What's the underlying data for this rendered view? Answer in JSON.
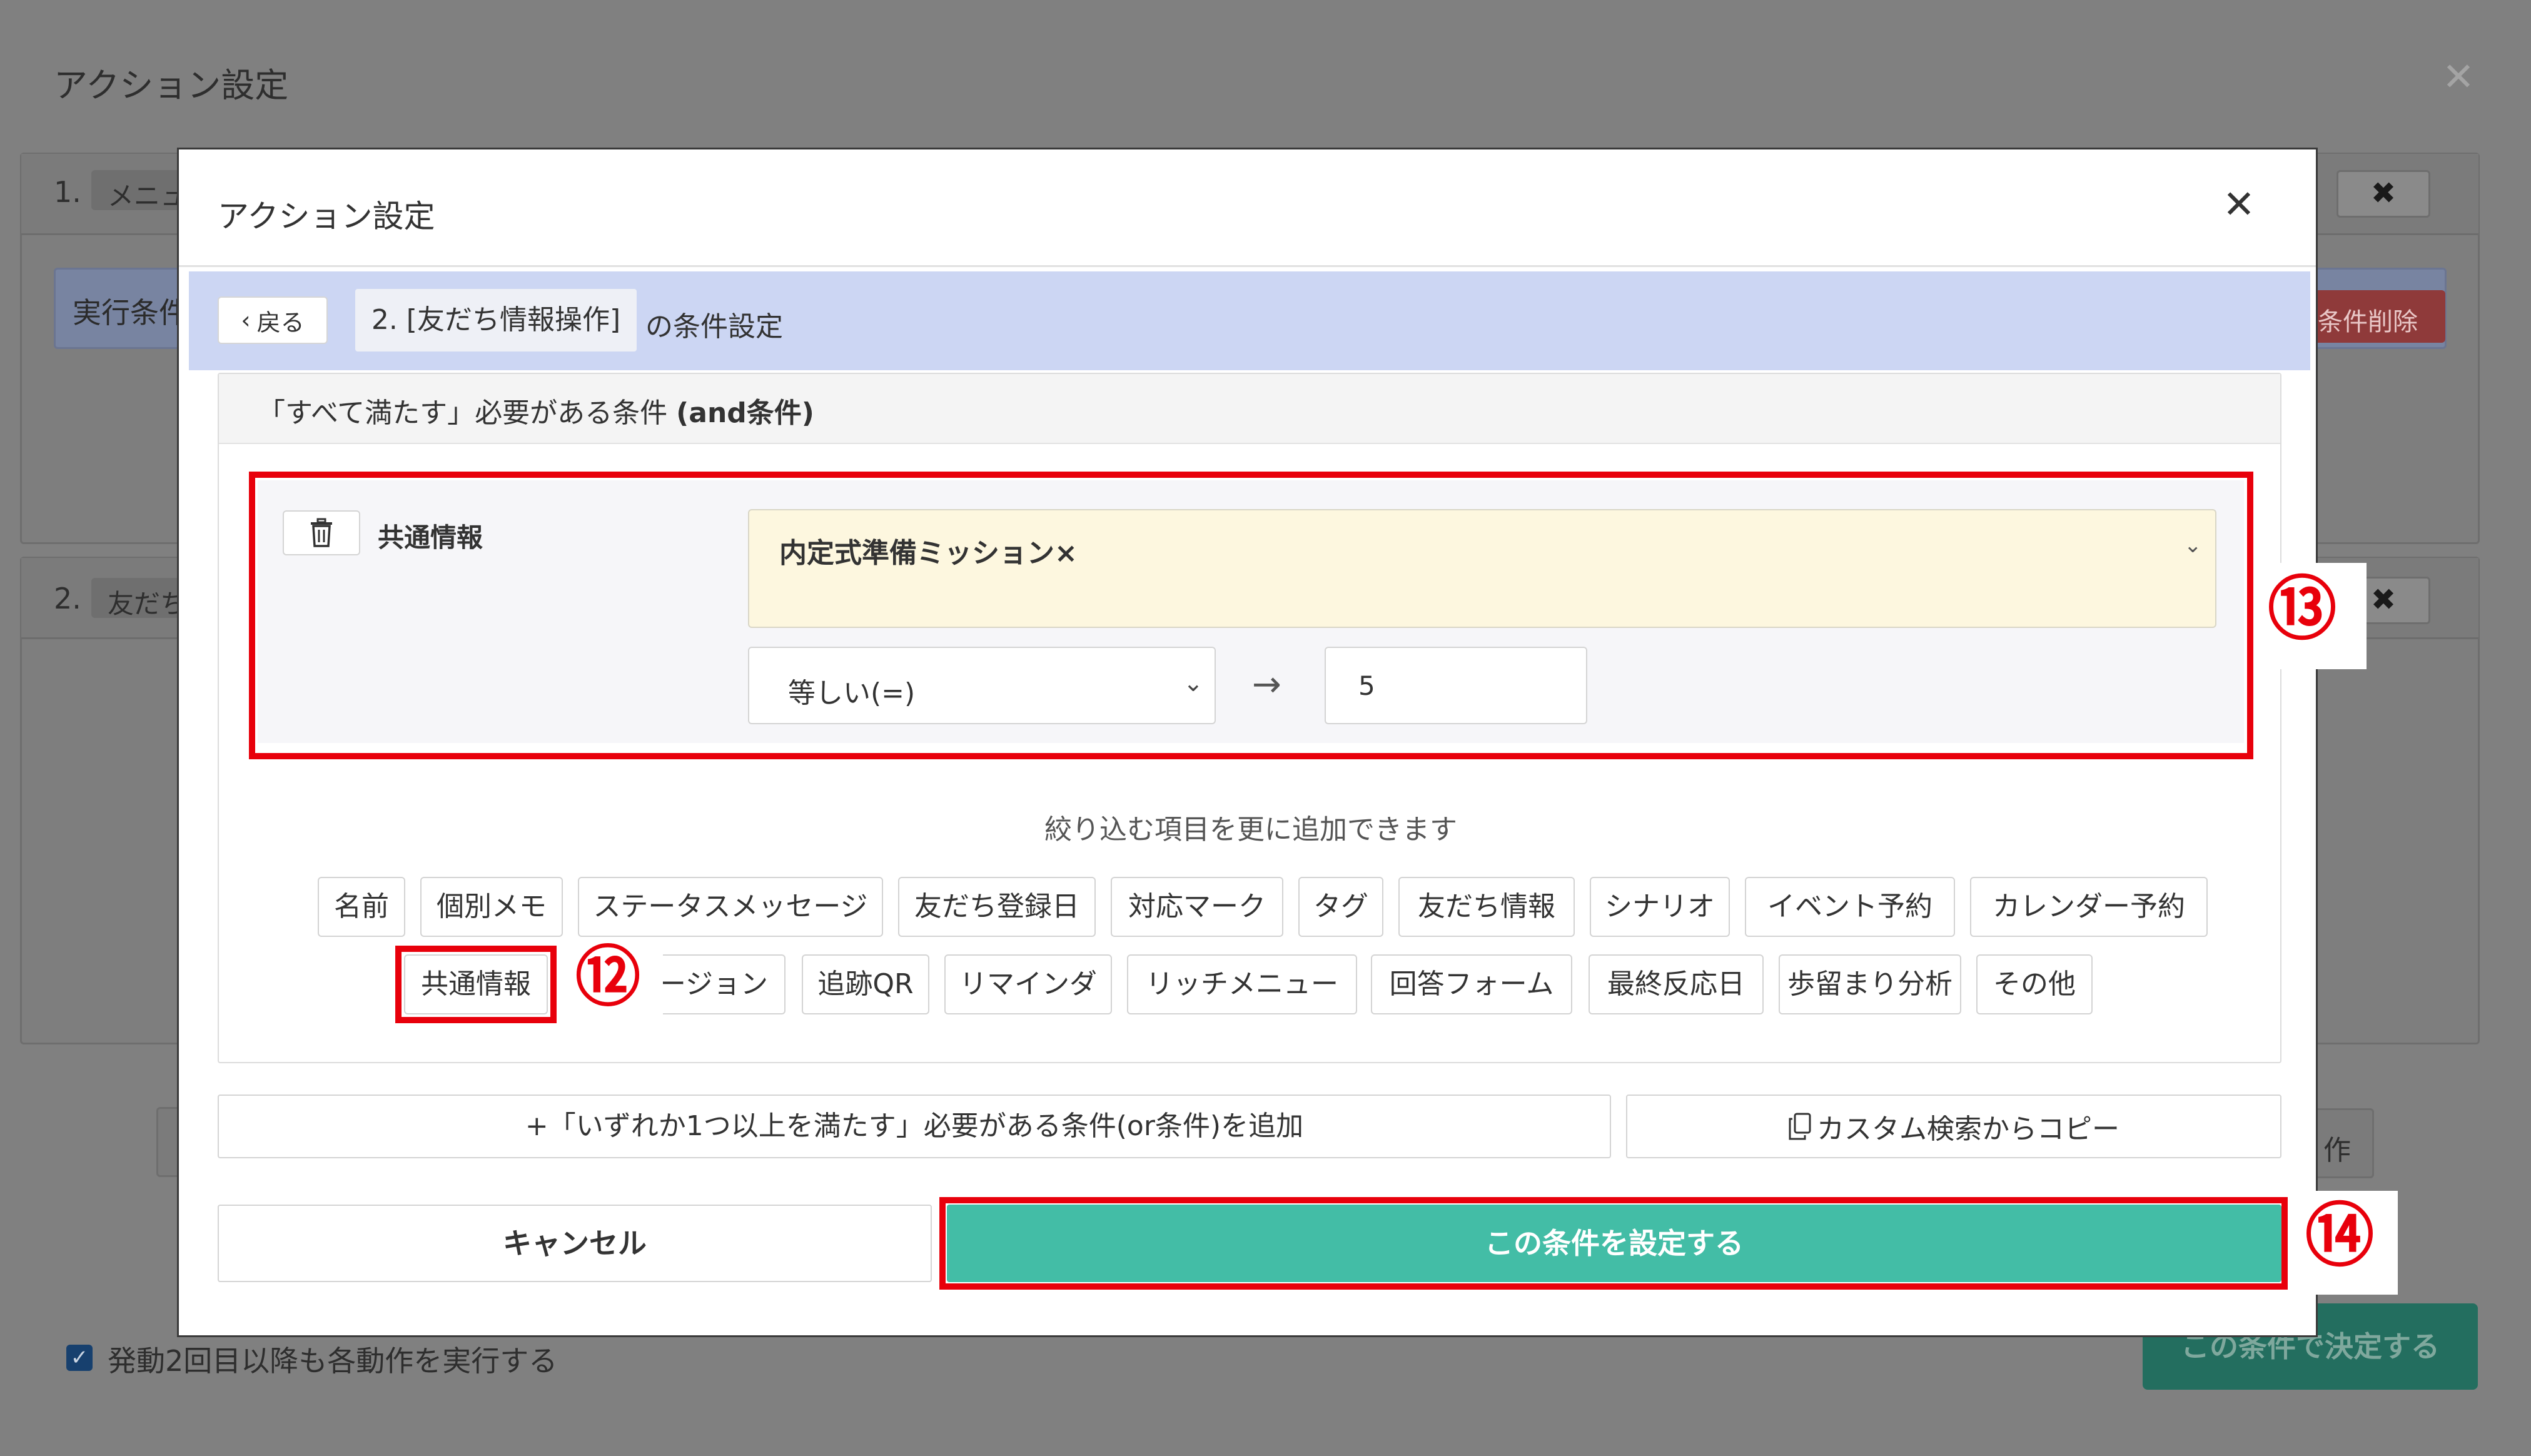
{
  "background": {
    "title": "アクション設定",
    "close_glyph": "✕",
    "rows": [
      {
        "number": "1.",
        "chip": "メニュー"
      },
      {
        "number": "2.",
        "chip": "友だち"
      }
    ],
    "condition_label": "実行条件",
    "delete_condition_label": "条件削除",
    "x_button": "✖",
    "stub_right_label": "作",
    "checkbox_mark": "✓",
    "checkbox_label": "発動2回目以降も各動作を実行する",
    "decide_button": "この条件で決定する"
  },
  "modal": {
    "title": "アクション設定",
    "close_glyph": "✕",
    "breadcrumb": {
      "back_chevron": "‹",
      "back_label": "戻る",
      "step": "2. [友だち情報操作]",
      "suffix": "の条件設定"
    },
    "and_card": {
      "title_prefix": "「すべて満たす」必要がある条件 ",
      "title_bold": "(and条件)"
    },
    "condition": {
      "field_label": "共通情報",
      "selected_value": "内定式準備ミッション×",
      "chevron": "⌄",
      "operator": "等しい(=)",
      "operator_chevron": "⌄",
      "arrow": "→",
      "value": "5"
    },
    "add_hint": "絞り込む項目を更に追加できます",
    "filter_tags_row1": [
      "名前",
      "個別メモ",
      "ステータスメッセージ",
      "友だち登録日",
      "対応マーク",
      "タグ",
      "友だち情報",
      "シナリオ",
      "イベント予約",
      "カレンダー予約"
    ],
    "filter_tags_row2": [
      "共通情報",
      "ージョン",
      "追跡QR",
      "リマインダ",
      "リッチメニュー",
      "回答フォーム",
      "最終反応日",
      "歩留まり分析",
      "その他"
    ],
    "add_or_label": "+「いずれか1つ以上を満たす」必要がある条件(or条件)を追加",
    "copy_label": "カスタム検索からコピー",
    "cancel_label": "キャンセル",
    "set_label": "この条件を設定する"
  },
  "annotations": {
    "marker_12": "⑫",
    "marker_13": "⑬",
    "marker_14": "⑭",
    "highlight_color": "#e8000b"
  },
  "colors": {
    "breadcrumb_bg": "#ccd6f3",
    "multi_select_bg": "#fdf7df",
    "primary_button": "#43bda6"
  }
}
